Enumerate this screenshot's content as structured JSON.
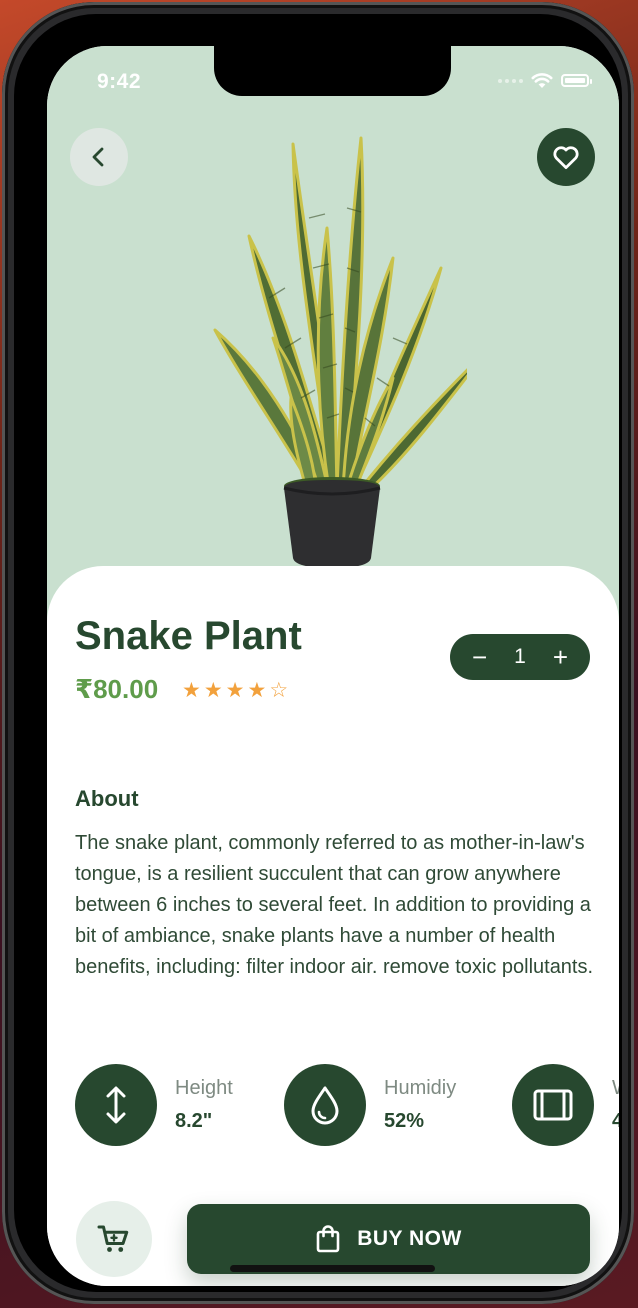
{
  "status_bar": {
    "time": "9:42"
  },
  "product": {
    "name": "Snake Plant",
    "price": "₹80.00",
    "rating": 4,
    "rating_max": 5,
    "quantity": "1",
    "quantity_minus": "−",
    "quantity_plus": "+"
  },
  "about": {
    "heading": "About",
    "text": "The snake plant, commonly referred to as mother-in-law's tongue, is a resilient succulent that can grow anywhere between 6 inches to several feet. In addition to providing a bit of ambiance, snake plants have a number of health benefits, including: filter indoor air. remove toxic pollutants."
  },
  "specs": [
    {
      "label": "Height",
      "value": "8.2\"",
      "icon": "height-arrows-icon"
    },
    {
      "label": "Humidiy",
      "value": "52%",
      "icon": "water-drop-icon"
    },
    {
      "label": "W",
      "value": "4",
      "icon": "width-frame-icon"
    }
  ],
  "actions": {
    "buy_label": "BUY NOW",
    "cart_icon": "cart-icon",
    "buy_icon": "shopping-bag-icon"
  },
  "colors": {
    "primary": "#27482f",
    "hero_bg": "#c9e0cf",
    "price": "#5f9c4b",
    "star": "#f2a13c"
  }
}
